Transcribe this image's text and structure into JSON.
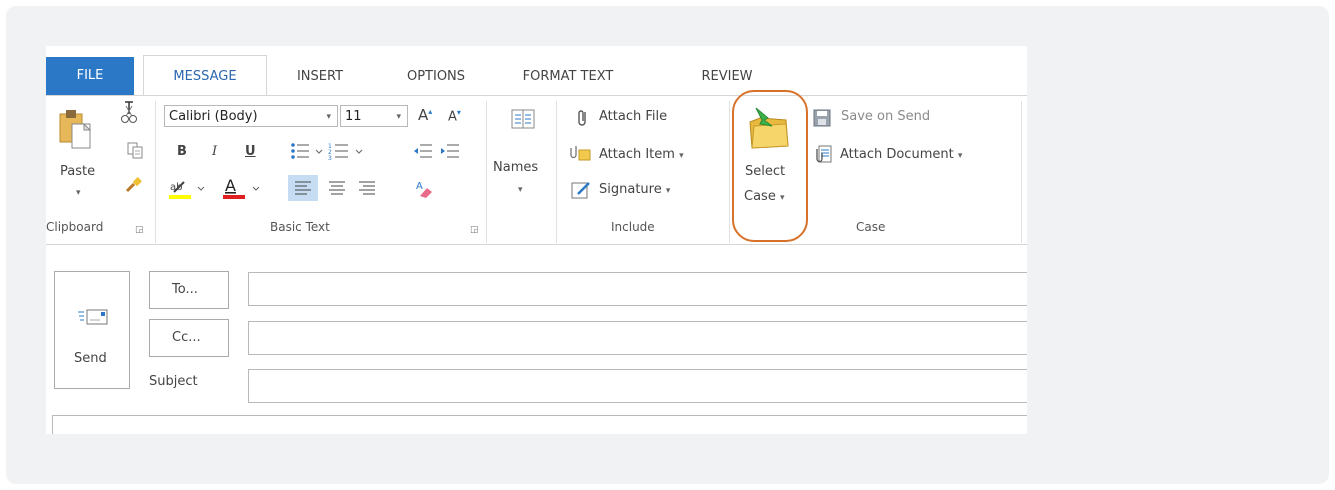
{
  "tabs": {
    "file": "FILE",
    "message": "MESSAGE",
    "insert": "INSERT",
    "options": "OPTIONS",
    "format_text": "FORMAT TEXT",
    "review": "REVIEW"
  },
  "clipboard": {
    "paste_label": "Paste",
    "group_label": "Clipboard"
  },
  "basic_text": {
    "font_name": "Calibri (Body)",
    "font_size": "11",
    "bold": "B",
    "italic": "I",
    "underline": "U",
    "group_label": "Basic Text"
  },
  "names": {
    "label": "Names"
  },
  "include": {
    "attach_file": "Attach File",
    "attach_item": "Attach Item",
    "signature": "Signature",
    "group_label": "Include"
  },
  "case": {
    "select_line1": "Select",
    "select_line2": "Case",
    "save_on_send": "Save on Send",
    "attach_document": "Attach Document",
    "group_label": "Case"
  },
  "compose": {
    "send_label": "Send",
    "to_label": "To...",
    "cc_label": "Cc...",
    "subject_label": "Subject",
    "to_value": "",
    "cc_value": "",
    "subject_value": ""
  },
  "colors": {
    "file_tab_bg": "#2b79c6",
    "active_tab_text": "#2b66b1",
    "highlight_oval": "#d8722a",
    "highlight_yellow": "#ffff00",
    "font_color_red": "#e02020"
  },
  "icons": {
    "cut": "scissors-icon",
    "copy": "copy-icon",
    "format_painter": "brush-icon",
    "paste": "clipboard-icon",
    "attach": "paperclip-icon",
    "signature": "signature-icon",
    "select_case": "folder-arrow-icon",
    "save": "floppy-icon",
    "attach_document": "document-attach-icon",
    "send": "envelope-icon"
  }
}
